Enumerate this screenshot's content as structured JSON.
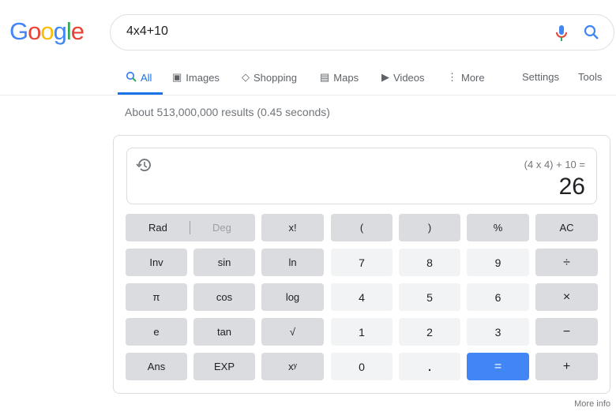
{
  "logo": "Google",
  "search": {
    "query": "4x4+10"
  },
  "tabs": [
    {
      "label": "All"
    },
    {
      "label": "Images"
    },
    {
      "label": "Shopping"
    },
    {
      "label": "Maps"
    },
    {
      "label": "Videos"
    },
    {
      "label": "More"
    }
  ],
  "settings": "Settings",
  "tools": "Tools",
  "stats": "About 513,000,000 results (0.45 seconds)",
  "calc": {
    "expression": "(4 x 4) + 10 =",
    "result": "26",
    "rad": "Rad",
    "deg": "Deg",
    "buttons": [
      "x!",
      "(",
      ")",
      "%",
      "AC",
      "Inv",
      "sin",
      "ln",
      "7",
      "8",
      "9",
      "÷",
      "π",
      "cos",
      "log",
      "4",
      "5",
      "6",
      "×",
      "e",
      "tan",
      "√",
      "1",
      "2",
      "3",
      "−",
      "Ans",
      "EXP",
      "xʸ",
      "0",
      ".",
      "=",
      "+"
    ]
  },
  "more_info": "More info",
  "colors": {
    "accent": "#1a73e8",
    "equals": "#4285f4"
  }
}
